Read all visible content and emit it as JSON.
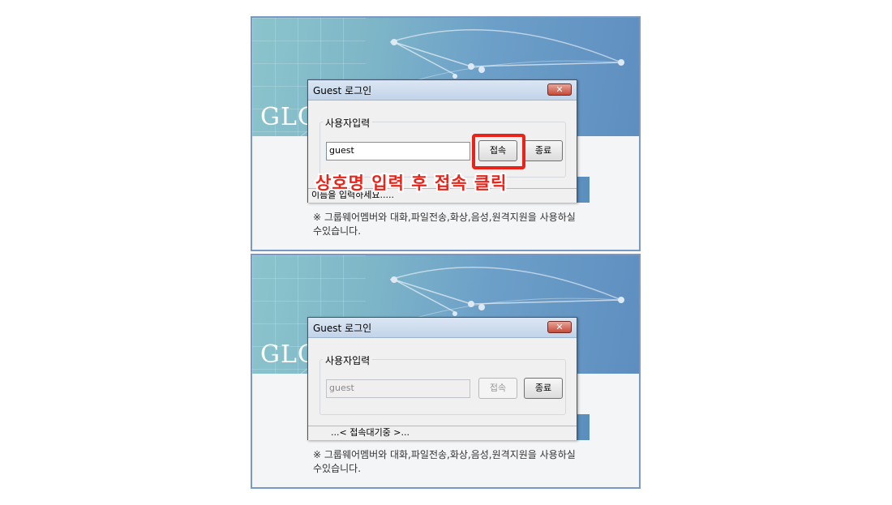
{
  "colors": {
    "annotation": "#e8241a",
    "frame": "#7a98c4",
    "banner": "#6c9fc8"
  },
  "logo_partial": "GLO",
  "panels": [
    {
      "dialog": {
        "title": "Guest 로그인",
        "close_icon": "close-icon",
        "group_label": "사용자입력",
        "input_value": "guest",
        "connect_label": "접속",
        "exit_label": "종료",
        "status": "이름을 입력하세요....."
      },
      "annotation": "상호명 입력 후 접속 클릭",
      "notice": "※ 그룹웨어멤버와 대화,파일전송,화상,음성,원격지원을 사용하실수있습니다."
    },
    {
      "dialog": {
        "title": "Guest 로그인",
        "close_icon": "close-icon",
        "group_label": "사용자입력",
        "input_value": "guest",
        "connect_label": "접속",
        "exit_label": "종료",
        "status": "...< 접속대기중 >..."
      },
      "notice": "※ 그룹웨어멤버와 대화,파일전송,화상,음성,원격지원을 사용하실수있습니다."
    }
  ]
}
